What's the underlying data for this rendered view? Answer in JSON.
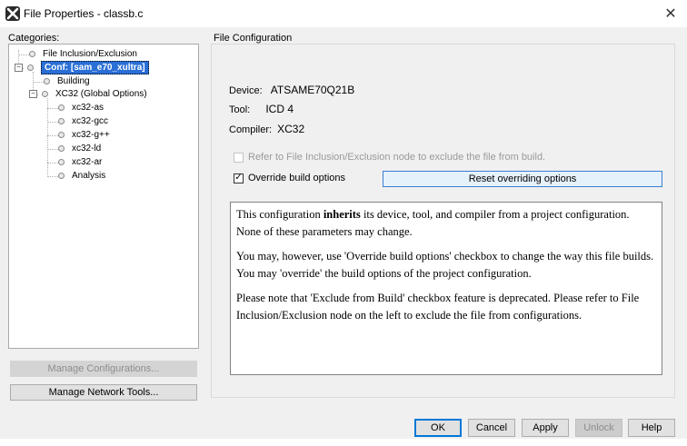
{
  "window": {
    "title": "File Properties - classb.c"
  },
  "categories": {
    "label": "Categories:",
    "tree": [
      {
        "label": "File Inclusion/Exclusion"
      },
      {
        "label": "Conf: [sam_e70_xultra]"
      },
      {
        "label": "Building"
      },
      {
        "label": "XC32 (Global Options)"
      },
      {
        "label": "xc32-as"
      },
      {
        "label": "xc32-gcc"
      },
      {
        "label": "xc32-g++"
      },
      {
        "label": "xc32-ld"
      },
      {
        "label": "xc32-ar"
      },
      {
        "label": "Analysis"
      }
    ],
    "manage_configurations_label": "Manage Configurations...",
    "manage_network_tools_label": "Manage Network Tools..."
  },
  "file_configuration": {
    "label": "File Configuration",
    "device_label": "Device:",
    "device_value": "ATSAME70Q21B",
    "tool_label": "Tool:",
    "tool_value": "ICD 4",
    "compiler_label": "Compiler:",
    "compiler_value": "XC32",
    "refer_checkbox_label": "Refer to File Inclusion/Exclusion node to exclude the file from build.",
    "override_checkbox_label": "Override build options",
    "reset_button_label": "Reset overriding options",
    "info": {
      "p1_before": "This configuration ",
      "p1_bold": "inherits",
      "p1_after": " its device, tool, and compiler from a project configuration. None of these parameters may change.",
      "p2": "You may, however, use 'Override build options' checkbox to change the way this file builds. You may 'override' the build options of the project configuration.",
      "p3": "Please note that 'Exclude from Build' checkbox feature is deprecated. Please refer to File Inclusion/Exclusion node on the left to exclude the file from configurations."
    }
  },
  "buttons": {
    "ok": "OK",
    "cancel": "Cancel",
    "apply": "Apply",
    "unlock": "Unlock",
    "help": "Help"
  }
}
